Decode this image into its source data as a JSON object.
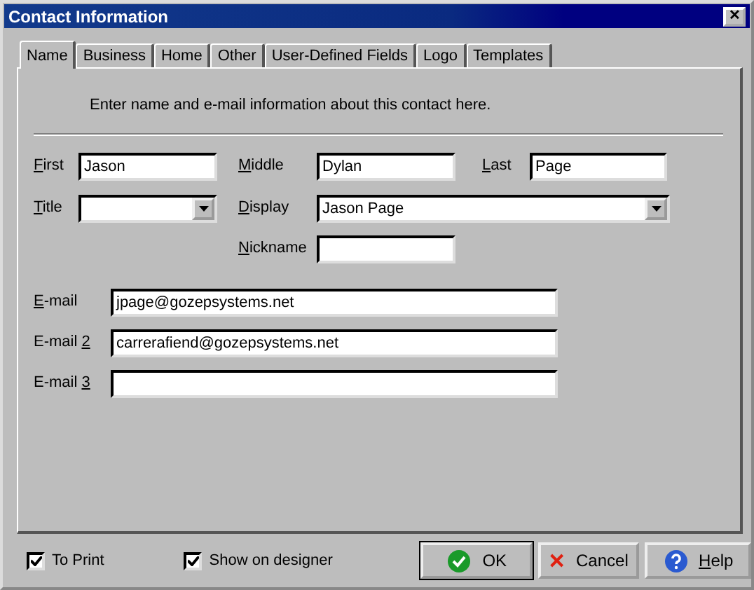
{
  "window": {
    "title": "Contact Information",
    "close": "✕"
  },
  "tabs": [
    {
      "label": "Name",
      "selected": true
    },
    {
      "label": "Business",
      "selected": false
    },
    {
      "label": "Home",
      "selected": false
    },
    {
      "label": "Other",
      "selected": false
    },
    {
      "label": "User-Defined Fields",
      "selected": false
    },
    {
      "label": "Logo",
      "selected": false
    },
    {
      "label": "Templates",
      "selected": false
    }
  ],
  "description": "Enter name and e-mail information about this contact here.",
  "name_fields": {
    "first": {
      "label": {
        "key": "F",
        "after": "irst"
      },
      "value": "Jason"
    },
    "middle": {
      "label": {
        "key": "M",
        "after": "iddle"
      },
      "value": "Dylan"
    },
    "last": {
      "label": {
        "key": "L",
        "after": "ast"
      },
      "value": "Page"
    },
    "title": {
      "label": {
        "key": "T",
        "after": "itle"
      }
    },
    "display": {
      "label": {
        "key": "D",
        "after": "isplay"
      },
      "value": "Jason Page"
    },
    "nickname": {
      "label": {
        "key": "N",
        "after": "ickname"
      }
    }
  },
  "emails": [
    {
      "label": {
        "key": "E",
        "after": "-mail"
      },
      "value": "jpage@gozepsystems.net"
    },
    {
      "label": {
        "before": "E-mail ",
        "key": "2"
      },
      "value": "carrerafiend@gozepsystems.net"
    },
    {
      "label": {
        "before": "E-mail ",
        "key": "3"
      }
    }
  ],
  "options": [
    {
      "label": "To Print",
      "checked": true
    },
    {
      "label": "Show on designer",
      "checked": true
    }
  ],
  "buttons": [
    {
      "kind": "ok",
      "label": "OK"
    },
    {
      "kind": "cancel",
      "label": "Cancel"
    },
    {
      "kind": "help",
      "label": {
        "key": "H",
        "after": "elp"
      }
    }
  ]
}
